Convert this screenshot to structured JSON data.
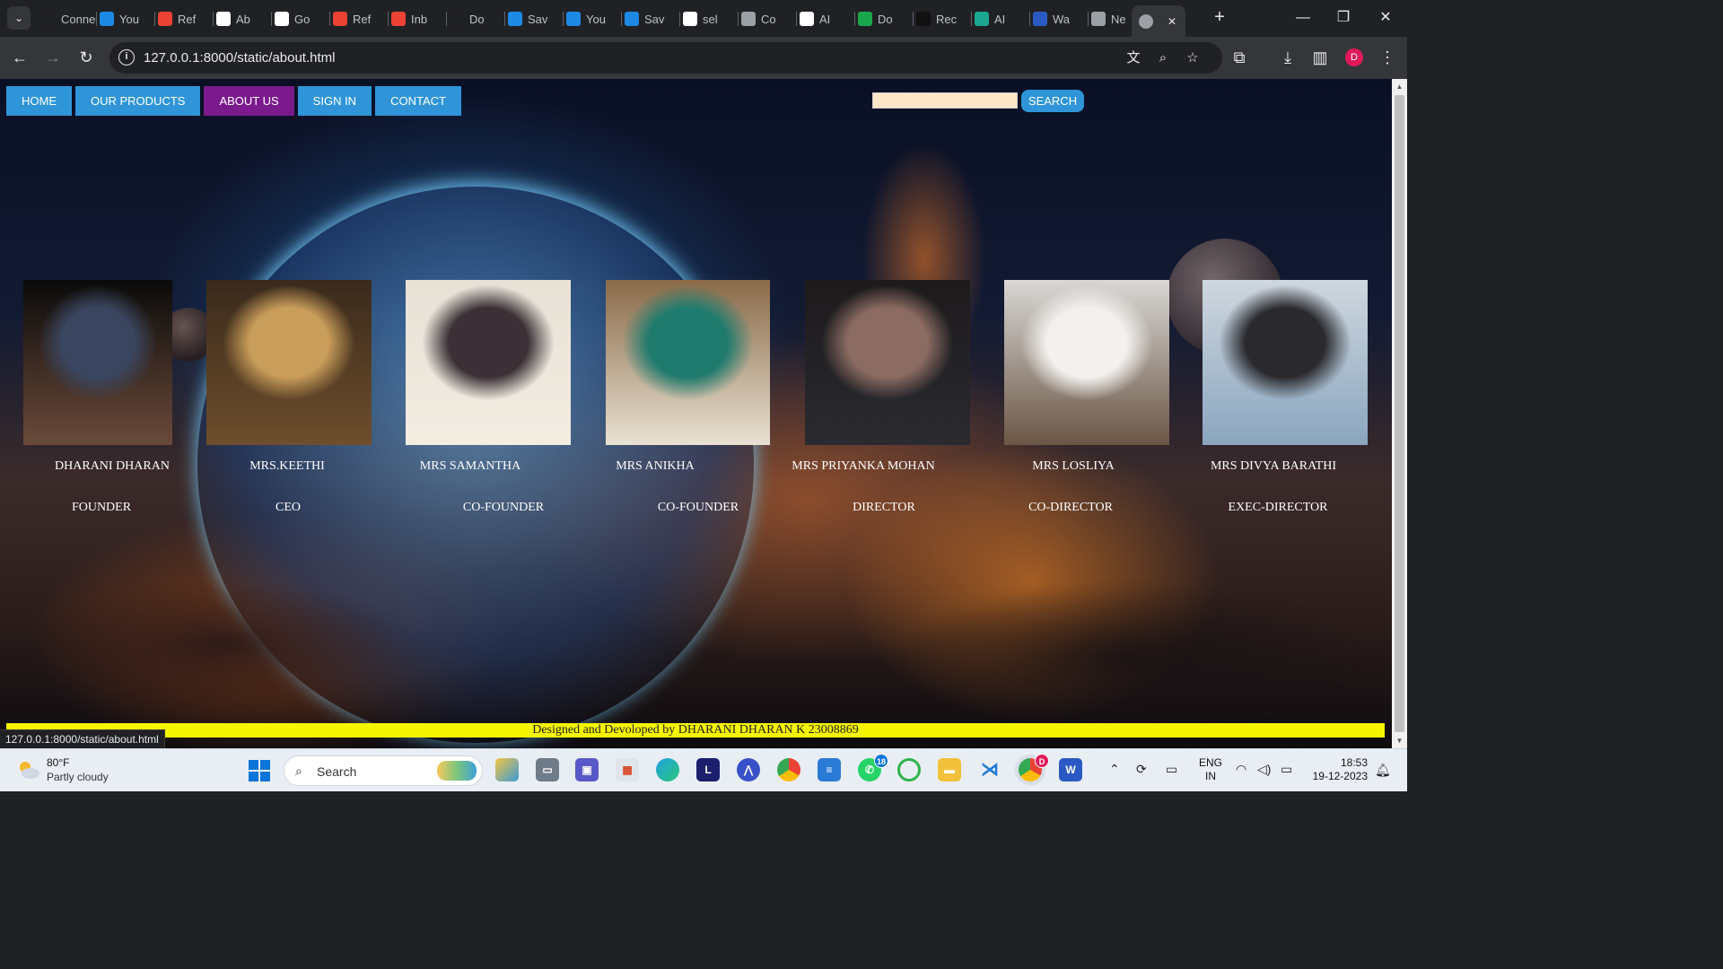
{
  "browser": {
    "tabs": [
      {
        "title": "Connec",
        "icon": "link-icon",
        "color": "#202124"
      },
      {
        "title": "You",
        "icon": "s-icon",
        "color": "#1e88e5"
      },
      {
        "title": "Ref",
        "icon": "gmail-icon",
        "color": "#ea4335"
      },
      {
        "title": "Ab",
        "icon": "google-icon",
        "color": "#ffffff"
      },
      {
        "title": "Go",
        "icon": "google-icon",
        "color": "#ffffff"
      },
      {
        "title": "Ref",
        "icon": "gmail-icon",
        "color": "#ea4335"
      },
      {
        "title": "Inb",
        "icon": "gmail-icon",
        "color": "#ea4335"
      },
      {
        "title": "Do",
        "icon": "download-icon",
        "color": "#202124"
      },
      {
        "title": "Sav",
        "icon": "s-icon",
        "color": "#1e88e5"
      },
      {
        "title": "You",
        "icon": "s-icon",
        "color": "#1e88e5"
      },
      {
        "title": "Sav",
        "icon": "s-icon",
        "color": "#1e88e5"
      },
      {
        "title": "sel",
        "icon": "github-icon",
        "color": "#ffffff"
      },
      {
        "title": "Co",
        "icon": "globe-icon",
        "color": "#9aa0a6"
      },
      {
        "title": "AI",
        "icon": "google-icon",
        "color": "#ffffff"
      },
      {
        "title": "Do",
        "icon": "px-icon",
        "color": "#1aa64a"
      },
      {
        "title": "Rec",
        "icon": "is-icon",
        "color": "#111111"
      },
      {
        "title": "AI",
        "icon": "doc-icon",
        "color": "#1aa690"
      },
      {
        "title": "Wa",
        "icon": "w-icon",
        "color": "#2b59c3"
      },
      {
        "title": "Ne",
        "icon": "chrome-icon",
        "color": "#9aa0a6"
      }
    ],
    "active_tab": {
      "title": "",
      "icon": "globe-icon"
    },
    "url": "127.0.0.1:8000/static/about.html",
    "profile_initial": "D"
  },
  "site": {
    "nav": [
      {
        "label": "HOME",
        "active": false
      },
      {
        "label": "OUR PRODUCTS",
        "active": false
      },
      {
        "label": "ABOUT US",
        "active": true
      },
      {
        "label": "SIGN IN",
        "active": false
      },
      {
        "label": "CONTACT",
        "active": false
      }
    ],
    "search": {
      "placeholder": "",
      "button_label": "SEARCH"
    },
    "team": [
      {
        "name": "DHARANI DHARAN",
        "role": "FOUNDER",
        "photo": "man-portrait-suit"
      },
      {
        "name": "MRS.KEETHI",
        "role": "CEO",
        "photo": "woman-portrait-yellow-dress"
      },
      {
        "name": "MRS SAMANTHA",
        "role": "CO-FOUNDER",
        "photo": "woman-reading-book"
      },
      {
        "name": "MRS ANIKHA",
        "role": "CO-FOUNDER",
        "photo": "woman-portrait-green-top"
      },
      {
        "name": "MRS PRIYANKA MOHAN",
        "role": "DIRECTOR",
        "photo": "woman-portrait-close-up"
      },
      {
        "name": "MRS LOSLIYA",
        "role": "CO-DIRECTOR",
        "photo": "woman-sitting-white-dress"
      },
      {
        "name": "MRS DIVYA BARATHI",
        "role": "EXEC-DIRECTOR",
        "photo": "woman-at-laptop"
      }
    ],
    "footer": "Designed and Devoloped by DHARANI DHARAN K 23008869",
    "status_url": "127.0.0.1:8000/static/about.html"
  },
  "taskbar": {
    "weather_temp": "80°F",
    "weather_desc": "Partly cloudy",
    "search_label": "Search",
    "whatsapp_badge": "18",
    "chrome_badge": "D",
    "lang_top": "ENG",
    "lang_bottom": "IN",
    "time": "18:53",
    "date": "19-12-2023"
  },
  "colors": {
    "nav_button": "#2f95d8",
    "nav_active": "#7a1a8d",
    "footer_bar": "#f5f500"
  }
}
